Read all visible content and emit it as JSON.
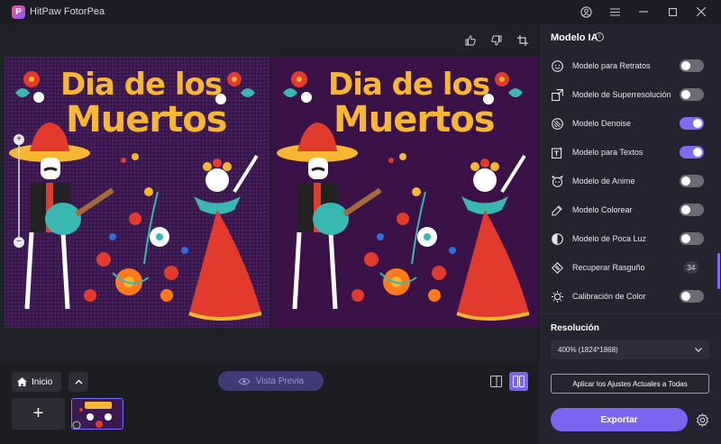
{
  "app": {
    "title": "HitPaw FotorPea",
    "logo_letter": "P"
  },
  "preview": {
    "poster_line1": "Dia de los",
    "poster_line2": "Muertos"
  },
  "bottom": {
    "inicio_label": "Inicio",
    "vista_previa_label": "Vista Previa",
    "add_label": "+"
  },
  "right_panel": {
    "title": "Modelo IA",
    "models": [
      {
        "label": "Modelo para Retratos",
        "icon": "portrait-icon",
        "enabled": false
      },
      {
        "label": "Modelo de Superresolución",
        "icon": "superres-icon",
        "enabled": false
      },
      {
        "label": "Modelo Denoise",
        "icon": "denoise-icon",
        "enabled": true
      },
      {
        "label": "Modelo para Textos",
        "icon": "text-icon",
        "enabled": true
      },
      {
        "label": "Modelo de Anime",
        "icon": "anime-icon",
        "enabled": false
      },
      {
        "label": "Modelo Colorear",
        "icon": "colorize-icon",
        "enabled": false
      },
      {
        "label": "Modelo de Poca Luz",
        "icon": "lowlight-icon",
        "enabled": false
      },
      {
        "label": "Recuperar Rasguño",
        "icon": "scratch-icon",
        "badge": "34"
      },
      {
        "label": "Calibración de Color",
        "icon": "calibration-icon",
        "enabled": false
      }
    ],
    "resolution_title": "Resolución",
    "resolution_value": "400% (1824*1868)",
    "apply_label": "Aplicar los Ajustes Actuales a Todas",
    "export_label": "Exportar"
  },
  "colors": {
    "accent": "#7a64f0",
    "background": "#1a1a21",
    "panel": "#242430",
    "poster_bg": "#3b1a4f",
    "poster_text": "#f7b731"
  }
}
